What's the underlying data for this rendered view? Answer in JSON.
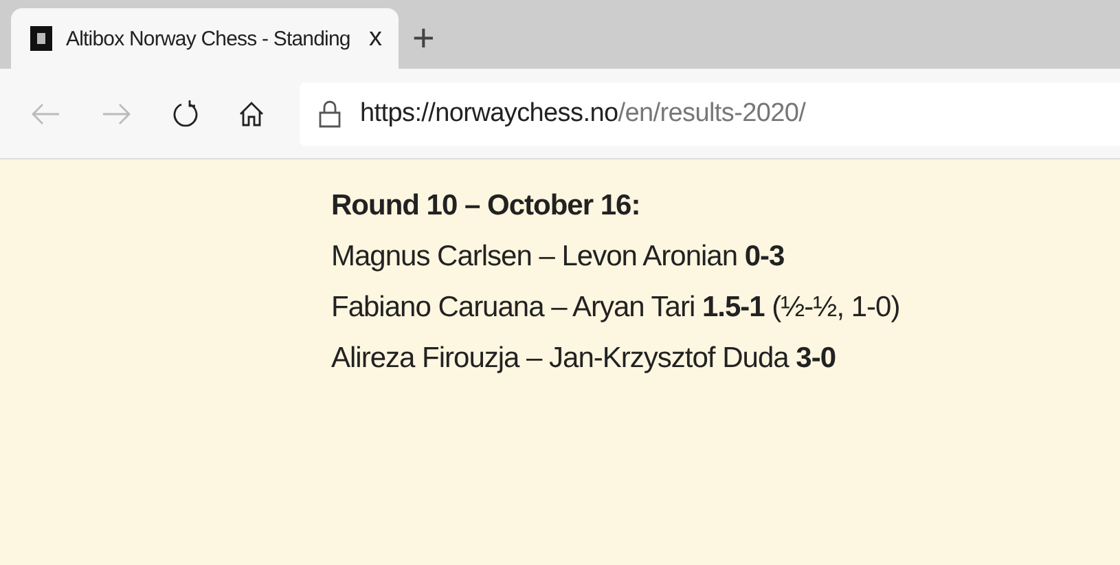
{
  "tab": {
    "title": "Altibox Norway Chess - Standing",
    "close": "x",
    "new_tab": "+"
  },
  "address_bar": {
    "host": "https://norwaychess.no",
    "path": "/en/results-2020/"
  },
  "content": {
    "heading": "Round 10 – October 16:",
    "results": [
      "Magnus Carlsen – Levon Aronian **0-3**",
      "Fabiano Caruana – Aryan Tari **1.5-1** (½-½, 1-0)",
      "Alireza Firouzja – Jan-Krzysztof Duda **3-0**"
    ]
  }
}
